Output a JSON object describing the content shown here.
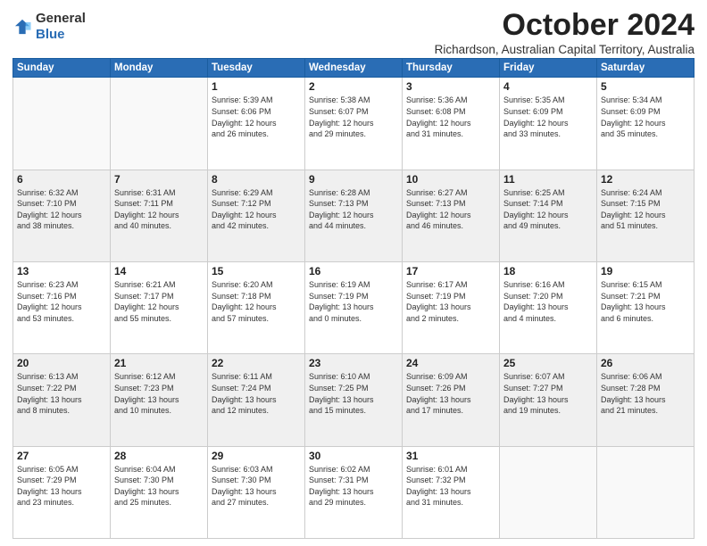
{
  "logo": {
    "general": "General",
    "blue": "Blue"
  },
  "title": "October 2024",
  "subtitle": "Richardson, Australian Capital Territory, Australia",
  "days_of_week": [
    "Sunday",
    "Monday",
    "Tuesday",
    "Wednesday",
    "Thursday",
    "Friday",
    "Saturday"
  ],
  "weeks": [
    [
      {
        "day": "",
        "info": ""
      },
      {
        "day": "",
        "info": ""
      },
      {
        "day": "1",
        "info": "Sunrise: 5:39 AM\nSunset: 6:06 PM\nDaylight: 12 hours\nand 26 minutes."
      },
      {
        "day": "2",
        "info": "Sunrise: 5:38 AM\nSunset: 6:07 PM\nDaylight: 12 hours\nand 29 minutes."
      },
      {
        "day": "3",
        "info": "Sunrise: 5:36 AM\nSunset: 6:08 PM\nDaylight: 12 hours\nand 31 minutes."
      },
      {
        "day": "4",
        "info": "Sunrise: 5:35 AM\nSunset: 6:09 PM\nDaylight: 12 hours\nand 33 minutes."
      },
      {
        "day": "5",
        "info": "Sunrise: 5:34 AM\nSunset: 6:09 PM\nDaylight: 12 hours\nand 35 minutes."
      }
    ],
    [
      {
        "day": "6",
        "info": "Sunrise: 6:32 AM\nSunset: 7:10 PM\nDaylight: 12 hours\nand 38 minutes."
      },
      {
        "day": "7",
        "info": "Sunrise: 6:31 AM\nSunset: 7:11 PM\nDaylight: 12 hours\nand 40 minutes."
      },
      {
        "day": "8",
        "info": "Sunrise: 6:29 AM\nSunset: 7:12 PM\nDaylight: 12 hours\nand 42 minutes."
      },
      {
        "day": "9",
        "info": "Sunrise: 6:28 AM\nSunset: 7:13 PM\nDaylight: 12 hours\nand 44 minutes."
      },
      {
        "day": "10",
        "info": "Sunrise: 6:27 AM\nSunset: 7:13 PM\nDaylight: 12 hours\nand 46 minutes."
      },
      {
        "day": "11",
        "info": "Sunrise: 6:25 AM\nSunset: 7:14 PM\nDaylight: 12 hours\nand 49 minutes."
      },
      {
        "day": "12",
        "info": "Sunrise: 6:24 AM\nSunset: 7:15 PM\nDaylight: 12 hours\nand 51 minutes."
      }
    ],
    [
      {
        "day": "13",
        "info": "Sunrise: 6:23 AM\nSunset: 7:16 PM\nDaylight: 12 hours\nand 53 minutes."
      },
      {
        "day": "14",
        "info": "Sunrise: 6:21 AM\nSunset: 7:17 PM\nDaylight: 12 hours\nand 55 minutes."
      },
      {
        "day": "15",
        "info": "Sunrise: 6:20 AM\nSunset: 7:18 PM\nDaylight: 12 hours\nand 57 minutes."
      },
      {
        "day": "16",
        "info": "Sunrise: 6:19 AM\nSunset: 7:19 PM\nDaylight: 13 hours\nand 0 minutes."
      },
      {
        "day": "17",
        "info": "Sunrise: 6:17 AM\nSunset: 7:19 PM\nDaylight: 13 hours\nand 2 minutes."
      },
      {
        "day": "18",
        "info": "Sunrise: 6:16 AM\nSunset: 7:20 PM\nDaylight: 13 hours\nand 4 minutes."
      },
      {
        "day": "19",
        "info": "Sunrise: 6:15 AM\nSunset: 7:21 PM\nDaylight: 13 hours\nand 6 minutes."
      }
    ],
    [
      {
        "day": "20",
        "info": "Sunrise: 6:13 AM\nSunset: 7:22 PM\nDaylight: 13 hours\nand 8 minutes."
      },
      {
        "day": "21",
        "info": "Sunrise: 6:12 AM\nSunset: 7:23 PM\nDaylight: 13 hours\nand 10 minutes."
      },
      {
        "day": "22",
        "info": "Sunrise: 6:11 AM\nSunset: 7:24 PM\nDaylight: 13 hours\nand 12 minutes."
      },
      {
        "day": "23",
        "info": "Sunrise: 6:10 AM\nSunset: 7:25 PM\nDaylight: 13 hours\nand 15 minutes."
      },
      {
        "day": "24",
        "info": "Sunrise: 6:09 AM\nSunset: 7:26 PM\nDaylight: 13 hours\nand 17 minutes."
      },
      {
        "day": "25",
        "info": "Sunrise: 6:07 AM\nSunset: 7:27 PM\nDaylight: 13 hours\nand 19 minutes."
      },
      {
        "day": "26",
        "info": "Sunrise: 6:06 AM\nSunset: 7:28 PM\nDaylight: 13 hours\nand 21 minutes."
      }
    ],
    [
      {
        "day": "27",
        "info": "Sunrise: 6:05 AM\nSunset: 7:29 PM\nDaylight: 13 hours\nand 23 minutes."
      },
      {
        "day": "28",
        "info": "Sunrise: 6:04 AM\nSunset: 7:30 PM\nDaylight: 13 hours\nand 25 minutes."
      },
      {
        "day": "29",
        "info": "Sunrise: 6:03 AM\nSunset: 7:30 PM\nDaylight: 13 hours\nand 27 minutes."
      },
      {
        "day": "30",
        "info": "Sunrise: 6:02 AM\nSunset: 7:31 PM\nDaylight: 13 hours\nand 29 minutes."
      },
      {
        "day": "31",
        "info": "Sunrise: 6:01 AM\nSunset: 7:32 PM\nDaylight: 13 hours\nand 31 minutes."
      },
      {
        "day": "",
        "info": ""
      },
      {
        "day": "",
        "info": ""
      }
    ]
  ]
}
